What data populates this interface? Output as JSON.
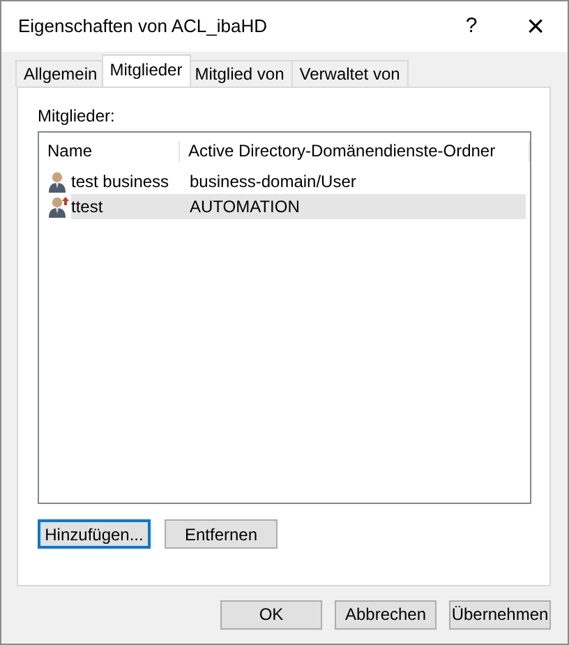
{
  "window": {
    "title": "Eigenschaften von ACL_ibaHD",
    "help": "?",
    "close": "×"
  },
  "tabs": [
    {
      "label": "Allgemein",
      "selected": false
    },
    {
      "label": "Mitglieder",
      "selected": true
    },
    {
      "label": "Mitglied von",
      "selected": false
    },
    {
      "label": "Verwaltet von",
      "selected": false
    }
  ],
  "members": {
    "label": "Mitglieder:",
    "columns": [
      "Name",
      "Active Directory-Domänendienste-Ordner"
    ],
    "rows": [
      {
        "name": "test business",
        "folder": "business-domain/User",
        "kind": "user",
        "selected": false
      },
      {
        "name": "ttest",
        "folder": "AUTOMATION",
        "kind": "user-linked",
        "selected": true
      }
    ]
  },
  "list_buttons": [
    {
      "label": "Hinzufügen...",
      "focused": true
    },
    {
      "label": "Entfernen",
      "focused": false
    }
  ],
  "buttons": [
    "OK",
    "Abbrechen",
    "Übernehmen"
  ]
}
